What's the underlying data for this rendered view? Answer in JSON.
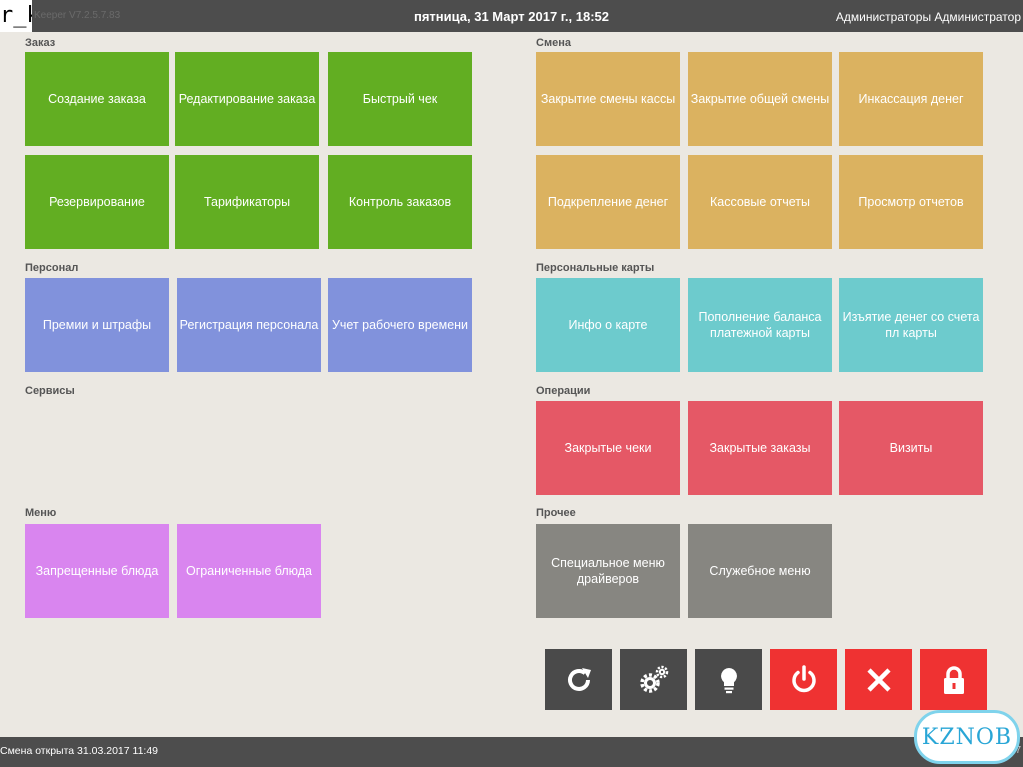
{
  "topbar": {
    "logo_text": "r_k",
    "version": "Keeper V7.2.5.7.83",
    "datetime": "пятница, 31 Март 2017 г., 18:52",
    "user": "Администраторы Администратор"
  },
  "sections": {
    "order": {
      "title": "Заказ",
      "tiles": [
        "Создание заказа",
        "Редактирование заказа",
        "Быстрый чек",
        "Резервирование",
        "Тарификаторы",
        "Контроль заказов"
      ]
    },
    "shift": {
      "title": "Смена",
      "tiles": [
        "Закрытие смены кассы",
        "Закрытие общей смены",
        "Инкассация денег",
        "Подкрепление денег",
        "Кассовые отчеты",
        "Просмотр отчетов"
      ]
    },
    "staff": {
      "title": "Персонал",
      "tiles": [
        "Премии и штрафы",
        "Регистрация персонала",
        "Учет рабочего времени"
      ]
    },
    "cards": {
      "title": "Персональные карты",
      "tiles": [
        "Инфо о карте",
        "Пополнение баланса\nплатежной карты",
        "Изъятие денег со счета\nпл карты"
      ]
    },
    "services": {
      "title": "Сервисы"
    },
    "operations": {
      "title": "Операции",
      "tiles": [
        "Закрытые чеки",
        "Закрытые заказы",
        "Визиты"
      ]
    },
    "menu": {
      "title": "Меню",
      "tiles": [
        "Запрещенные блюда",
        "Ограниченные блюда"
      ]
    },
    "other": {
      "title": "Прочее",
      "tiles": [
        "Специальное меню\nдрайверов",
        "Служебное меню"
      ]
    }
  },
  "controls": {
    "refresh_icon": "refresh-icon",
    "settings_icon": "gears-icon",
    "hint_icon": "lightbulb-icon",
    "power_icon": "power-icon",
    "close_icon": "close-icon",
    "lock_icon": "lock-icon"
  },
  "colors": {
    "order": "#62ae22",
    "shift": "#dbb260",
    "staff": "#8192dc",
    "cards": "#6dcbcd",
    "operations": "#e55866",
    "menu": "#d985ef",
    "other": "#878681",
    "danger": "#ef3232",
    "dark": "#4a4a4a"
  },
  "statusbar": {
    "shift_opened": "Смена открыта 31.03.2017 11:49",
    "watermark": "KZNOB",
    "corner": "7"
  }
}
